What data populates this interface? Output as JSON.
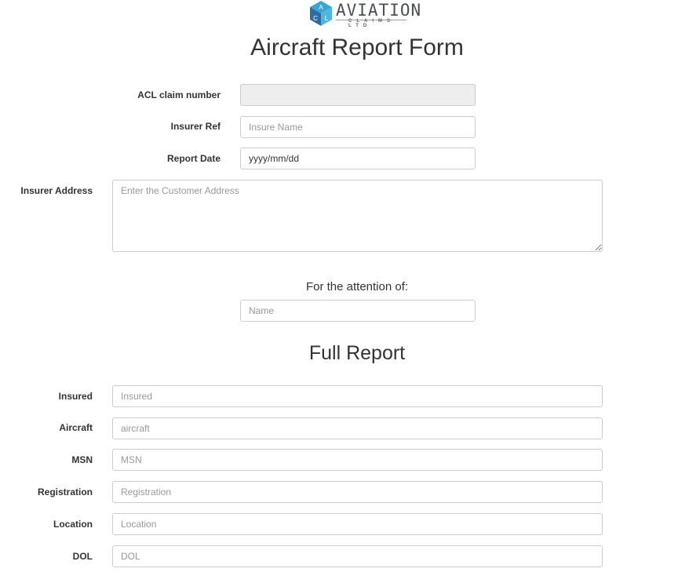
{
  "logo": {
    "letters": [
      "A",
      "C",
      "L"
    ],
    "name": "AVIATION",
    "subtitle": "CLAIMS LTD",
    "colors": {
      "blue": "#2e6ca4",
      "teal": "#3aa7d3",
      "text": "#4a4f59"
    }
  },
  "title": "Aircraft Report Form",
  "header_fields": {
    "claim_number": {
      "label": "ACL claim number",
      "value": "",
      "placeholder": ""
    },
    "insurer_ref": {
      "label": "Insurer Ref",
      "placeholder": "Insure Name"
    },
    "report_date": {
      "label": "Report Date",
      "value": "yyyy/mm/dd"
    },
    "insurer_address": {
      "label": "Insurer Address",
      "placeholder": "Enter the Customer Address"
    }
  },
  "attention": {
    "label": "For the attention of:",
    "placeholder": "Name"
  },
  "full_report": {
    "heading": "Full Report",
    "fields": [
      {
        "label": "Insured",
        "placeholder": "Insured"
      },
      {
        "label": "Aircraft",
        "placeholder": "aircraft"
      },
      {
        "label": "MSN",
        "placeholder": "MSN"
      },
      {
        "label": "Registration",
        "placeholder": "Registration"
      },
      {
        "label": "Location",
        "placeholder": "Location"
      },
      {
        "label": "DOL",
        "placeholder": "DOL"
      }
    ]
  }
}
